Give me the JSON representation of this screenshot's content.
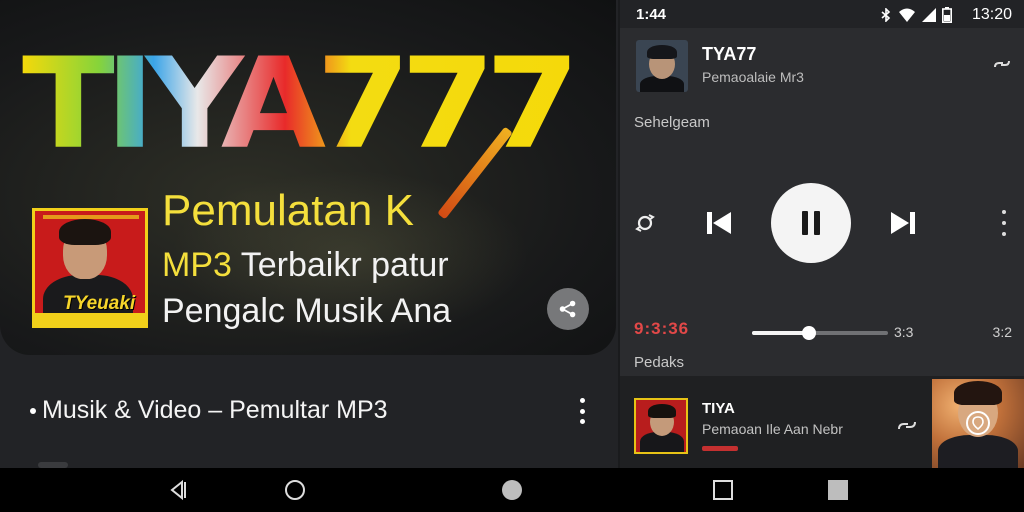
{
  "banner": {
    "logo_text": "TIYA777",
    "tagline_line1": "Pemulatan K",
    "tagline_line2_accent": "MP3",
    "tagline_line2_rest": " Terbaikr patur",
    "tagline_line3": "Pengalc Musik Ana",
    "album_tag": "TYeuaki"
  },
  "list": {
    "item_label": "Musik & Video – Pemultar MP3"
  },
  "status_bar": {
    "time_left": "1:44",
    "time_right": "13:20"
  },
  "now_playing": {
    "title": "TYA77",
    "subtitle": "Pemaoalaie Mr3"
  },
  "section_label": "Sehelgeam",
  "player": {
    "elapsed": "9:3:36",
    "duration": "3:3",
    "total": "3:2",
    "progress": 0.42
  },
  "section2_label": "Pedaks",
  "queue": {
    "title": "TIYA",
    "subtitle": "Pemaoan Ile Aan Nebr"
  },
  "colors": {
    "accent_yellow": "#f4df3c",
    "accent_red": "#e24848",
    "background": "#1a1b1d"
  },
  "icons": {
    "share": "share-icon",
    "link": "link-icon",
    "shuffle": "shuffle-icon",
    "prev": "skip-previous-icon",
    "pause": "pause-icon",
    "next": "skip-next-icon",
    "more": "more-vert-icon",
    "nav_back": "back-icon",
    "nav_home": "home-icon",
    "nav_assist": "assistant-icon",
    "nav_recent": "recents-icon",
    "nav_square": "square-icon"
  }
}
